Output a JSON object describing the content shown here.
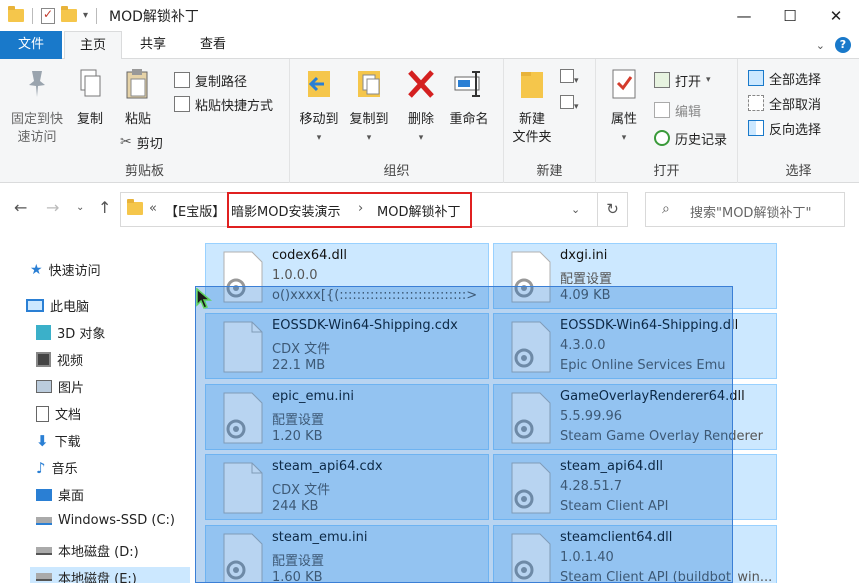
{
  "window": {
    "title": "MOD解锁补丁",
    "controls": [
      "—",
      "☐",
      "✕"
    ]
  },
  "tabs": {
    "file": "文件",
    "home": "主页",
    "share": "共享",
    "view": "查看"
  },
  "ribbon": {
    "clipboard": {
      "label": "剪贴板",
      "pin_l1": "固定到快",
      "pin_l2": "速访问",
      "copy": "复制",
      "paste": "粘贴",
      "copy_path": "复制路径",
      "paste_shortcut": "粘贴快捷方式",
      "cut": "剪切"
    },
    "organize": {
      "label": "组织",
      "move_to": "移动到",
      "copy_to": "复制到",
      "delete": "删除",
      "rename": "重命名"
    },
    "new": {
      "label": "新建",
      "new_folder_l1": "新建",
      "new_folder_l2": "文件夹"
    },
    "open": {
      "label": "打开",
      "properties": "属性",
      "open": "打开",
      "edit": "编辑",
      "history": "历史记录"
    },
    "select": {
      "label": "选择",
      "select_all": "全部选择",
      "select_none": "全部取消",
      "invert": "反向选择"
    }
  },
  "address": {
    "chevrons": "«",
    "crumb1": "【E宝版】",
    "crumb2": "暗影MOD安装演示",
    "sep": "›",
    "crumb3": "MOD解锁补丁",
    "search_placeholder": "搜索\"MOD解锁补丁\""
  },
  "nav": {
    "quick_access": "快速访问",
    "this_pc": "此电脑",
    "objects3d": "3D 对象",
    "videos": "视频",
    "pictures": "图片",
    "documents": "文档",
    "downloads": "下载",
    "music": "音乐",
    "desktop": "桌面",
    "drive_c": "Windows-SSD (C:)",
    "drive_d": "本地磁盘 (D:)",
    "drive_e": "本地磁盘 (E:)"
  },
  "files": [
    {
      "name": "codex64.dll",
      "line2": "1.0.0.0",
      "line3": "o()xxxx[{(:::::::::::::::::::::::::::::>",
      "icon": "gear-file"
    },
    {
      "name": "dxgi.ini",
      "line2": "配置设置",
      "line3": "4.09 KB",
      "icon": "gear-file"
    },
    {
      "name": "EOSSDK-Win64-Shipping.cdx",
      "line2": "CDX 文件",
      "line3": "22.1 MB",
      "icon": "blank-file"
    },
    {
      "name": "EOSSDK-Win64-Shipping.dll",
      "line2": "4.3.0.0",
      "line3": "Epic Online Services Emu",
      "icon": "gear-file"
    },
    {
      "name": "epic_emu.ini",
      "line2": "配置设置",
      "line3": "1.20 KB",
      "icon": "gear-file"
    },
    {
      "name": "GameOverlayRenderer64.dll",
      "line2": "5.5.99.96",
      "line3": "Steam Game Overlay Renderer",
      "icon": "gear-file"
    },
    {
      "name": "steam_api64.cdx",
      "line2": "CDX 文件",
      "line3": "244 KB",
      "icon": "blank-file"
    },
    {
      "name": "steam_api64.dll",
      "line2": "4.28.51.7",
      "line3": "Steam Client API",
      "icon": "gear-file"
    },
    {
      "name": "steam_emu.ini",
      "line2": "配置设置",
      "line3": "1.60 KB",
      "icon": "gear-file"
    },
    {
      "name": "steamclient64.dll",
      "line2": "1.0.1.40",
      "line3": "Steam Client API (buildbot_win...",
      "icon": "gear-file"
    }
  ],
  "colors": {
    "accent": "#1979ca",
    "selection": "#cce8ff",
    "marquee": "#3b7fd6",
    "highlight_box": "#e02020"
  }
}
